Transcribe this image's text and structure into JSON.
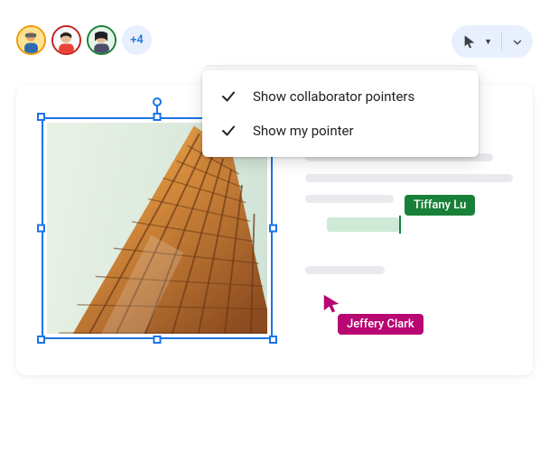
{
  "avatars": {
    "overflow": "+4"
  },
  "pointer_menu": {
    "items": [
      {
        "label": "Show collaborator pointers",
        "checked": true
      },
      {
        "label": "Show my pointer",
        "checked": true
      }
    ]
  },
  "collaborators": {
    "tiffany": {
      "name": "Tiffany Lu",
      "color": "#188038"
    },
    "jeffery": {
      "name": "Jeffery Clark",
      "color": "#b80672"
    }
  }
}
